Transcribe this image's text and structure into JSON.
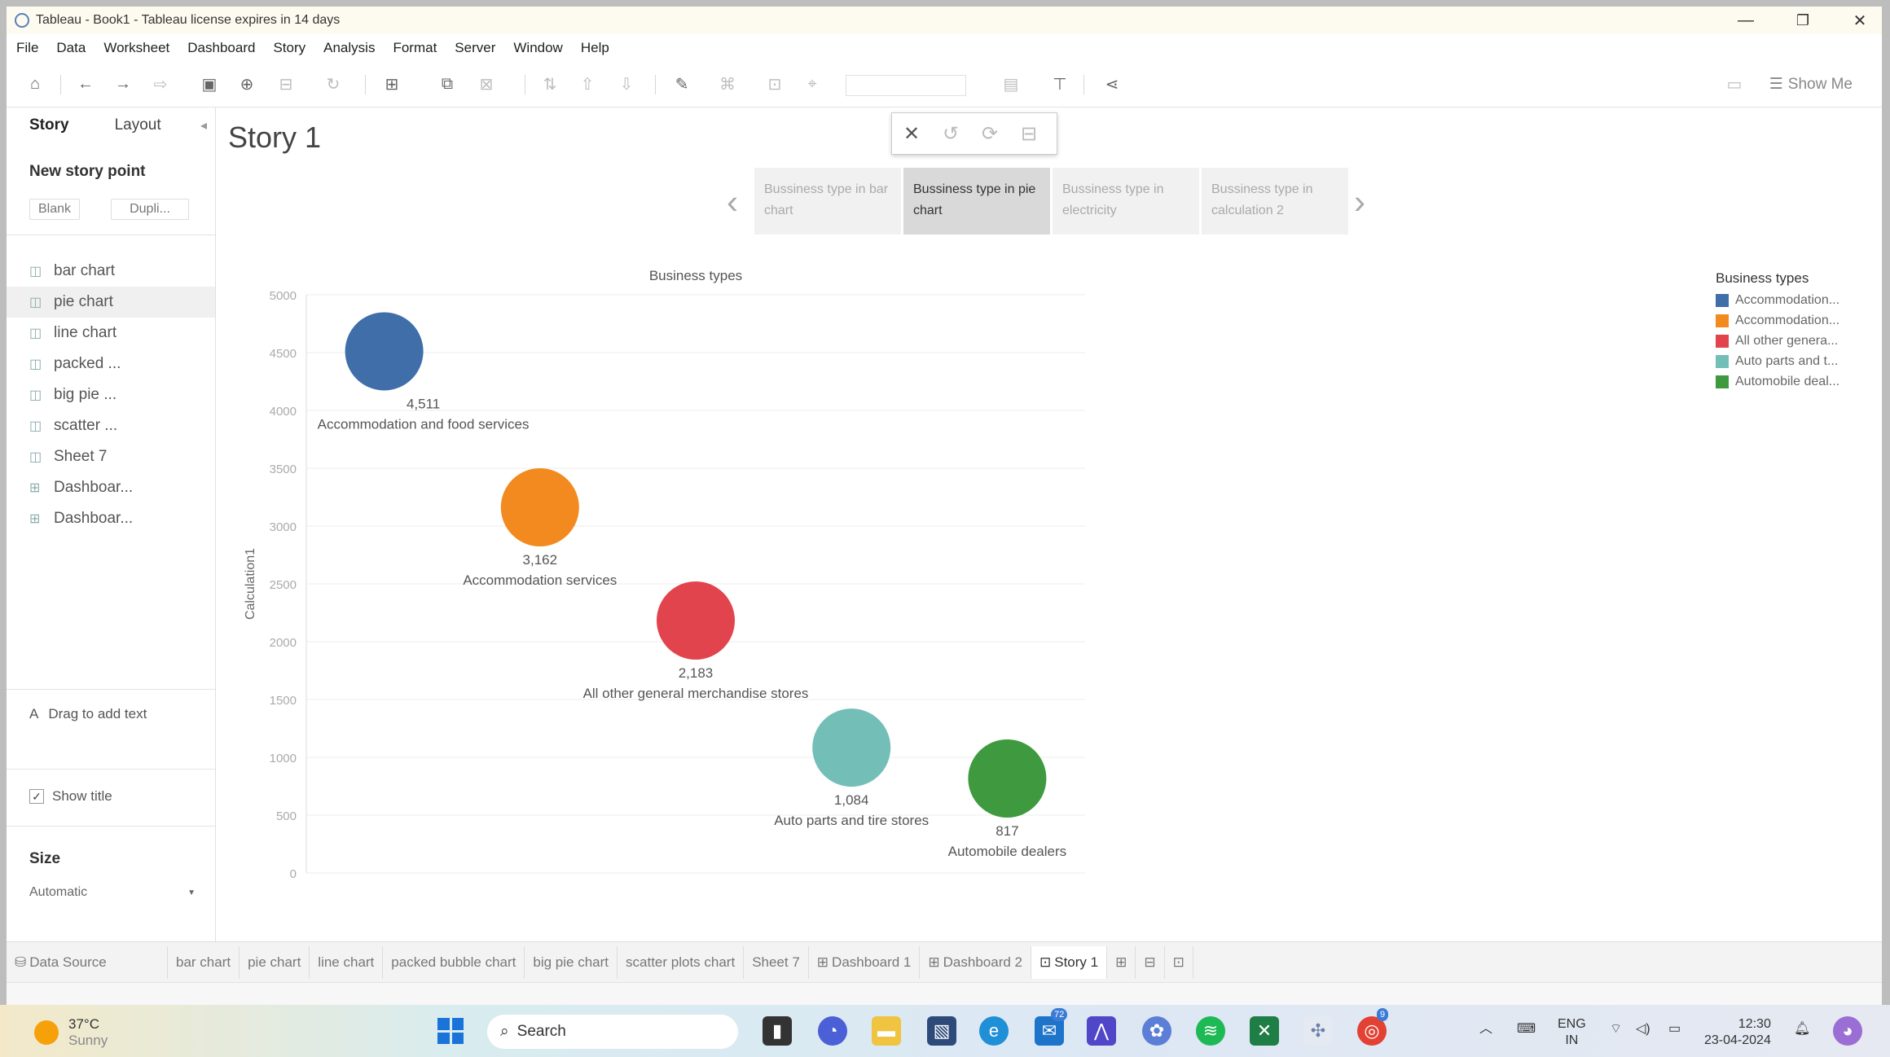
{
  "window": {
    "title": "Tableau - Book1 - Tableau license expires in 14 days",
    "minimize": "—",
    "restore": "❐",
    "close": "✕"
  },
  "menu": [
    "File",
    "Data",
    "Worksheet",
    "Dashboard",
    "Story",
    "Analysis",
    "Format",
    "Server",
    "Window",
    "Help"
  ],
  "toolbar": {
    "show_me": "Show Me"
  },
  "left_pane": {
    "tabs": [
      "Story",
      "Layout"
    ],
    "new_story_point": "New story point",
    "blank_button": "Blank",
    "duplicate_button": "Dupli...",
    "sheets": [
      {
        "label": "bar chart",
        "icon": "worksheet-icon"
      },
      {
        "label": "pie chart",
        "icon": "worksheet-icon"
      },
      {
        "label": "line chart",
        "icon": "worksheet-icon"
      },
      {
        "label": "packed ...",
        "icon": "worksheet-icon"
      },
      {
        "label": "big pie ...",
        "icon": "worksheet-icon"
      },
      {
        "label": "scatter ...",
        "icon": "worksheet-icon"
      },
      {
        "label": "Sheet 7",
        "icon": "worksheet-icon"
      },
      {
        "label": "Dashboar...",
        "icon": "dashboard-icon"
      },
      {
        "label": "Dashboar...",
        "icon": "dashboard-icon"
      }
    ],
    "drag_text": "Drag to add text",
    "show_title": "Show title",
    "size_label": "Size",
    "size_value": "Automatic"
  },
  "story": {
    "title": "Story 1",
    "points": [
      "Bussiness type in bar chart",
      "Bussiness type in pie chart",
      "Bussiness type in electricity",
      "Bussiness type in calculation 2"
    ],
    "active_point": 1
  },
  "chart_data": {
    "type": "scatter",
    "title": "Business types",
    "xlabel": "",
    "ylabel": "Calculation1",
    "ylim": [
      0,
      5000
    ],
    "yticks": [
      0,
      500,
      1000,
      1500,
      2000,
      2500,
      3000,
      3500,
      4000,
      4500,
      5000
    ],
    "grid": true,
    "categories": [
      "Accommodation and food services",
      "Accommodation services",
      "All other general merchandise stores",
      "Auto parts and tire stores",
      "Automobile dealers"
    ],
    "category_tick_labels": [
      "Accommodation and ...",
      "Accommodation serv...",
      "All other general mer...",
      "Auto parts and tire s...",
      "Automobile dealers"
    ],
    "values": [
      4511,
      3162,
      2183,
      1084,
      817
    ],
    "value_labels": [
      "4,511",
      "3,162",
      "2,183",
      "1,084",
      "817"
    ],
    "colors": [
      "#3f6ea9",
      "#f28a1f",
      "#e2444d",
      "#73bfb8",
      "#3f9a3f"
    ],
    "legend": {
      "title": "Business types",
      "placement": "right",
      "entries": [
        "Accommodation...",
        "Accommodation...",
        "All other genera...",
        "Auto parts and t...",
        "Automobile deal..."
      ]
    }
  },
  "bottom_tabs": {
    "data_source": "Data Source",
    "sheets": [
      "bar chart",
      "pie chart",
      "line chart",
      "packed bubble chart",
      "big pie chart",
      "scatter plots chart",
      "Sheet 7",
      "Dashboard 1",
      "Dashboard 2",
      "Story 1"
    ],
    "active": "Story 1"
  },
  "taskbar": {
    "temperature": "37°C",
    "condition": "Sunny",
    "search_placeholder": "Search",
    "mail_badge": "72",
    "chrome_badge": "9",
    "lang": "ENG",
    "region": "IN",
    "time": "12:30",
    "date": "23-04-2024"
  }
}
